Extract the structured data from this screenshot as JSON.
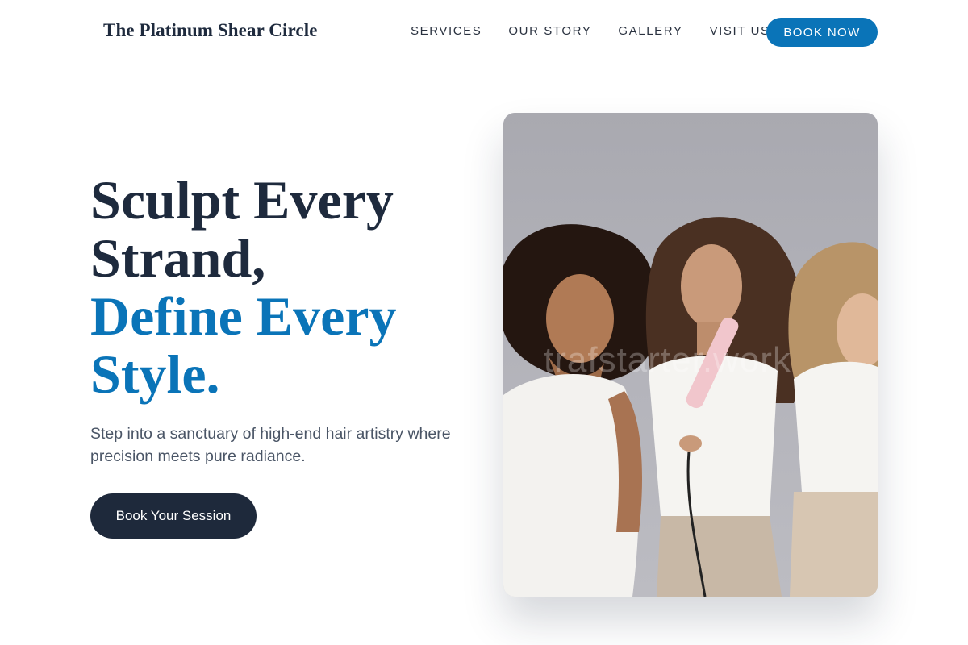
{
  "header": {
    "brand": "The Platinum Shear Circle",
    "nav": [
      "SERVICES",
      "OUR STORY",
      "GALLERY",
      "VISIT US"
    ],
    "cta": "BOOK NOW"
  },
  "hero": {
    "headline_lines": [
      "Sculpt Every",
      "Strand,"
    ],
    "headline_accent_lines": [
      "Define Every",
      "Style."
    ],
    "subtext": "Step into a sanctuary of high-end hair artistry where precision meets pure radiance.",
    "cta": "Book Your Session",
    "image_watermark": "trafstarter.work"
  },
  "colors": {
    "accent": "#0a74b8",
    "dark": "#1e293b",
    "text": "#1e2a3d"
  }
}
